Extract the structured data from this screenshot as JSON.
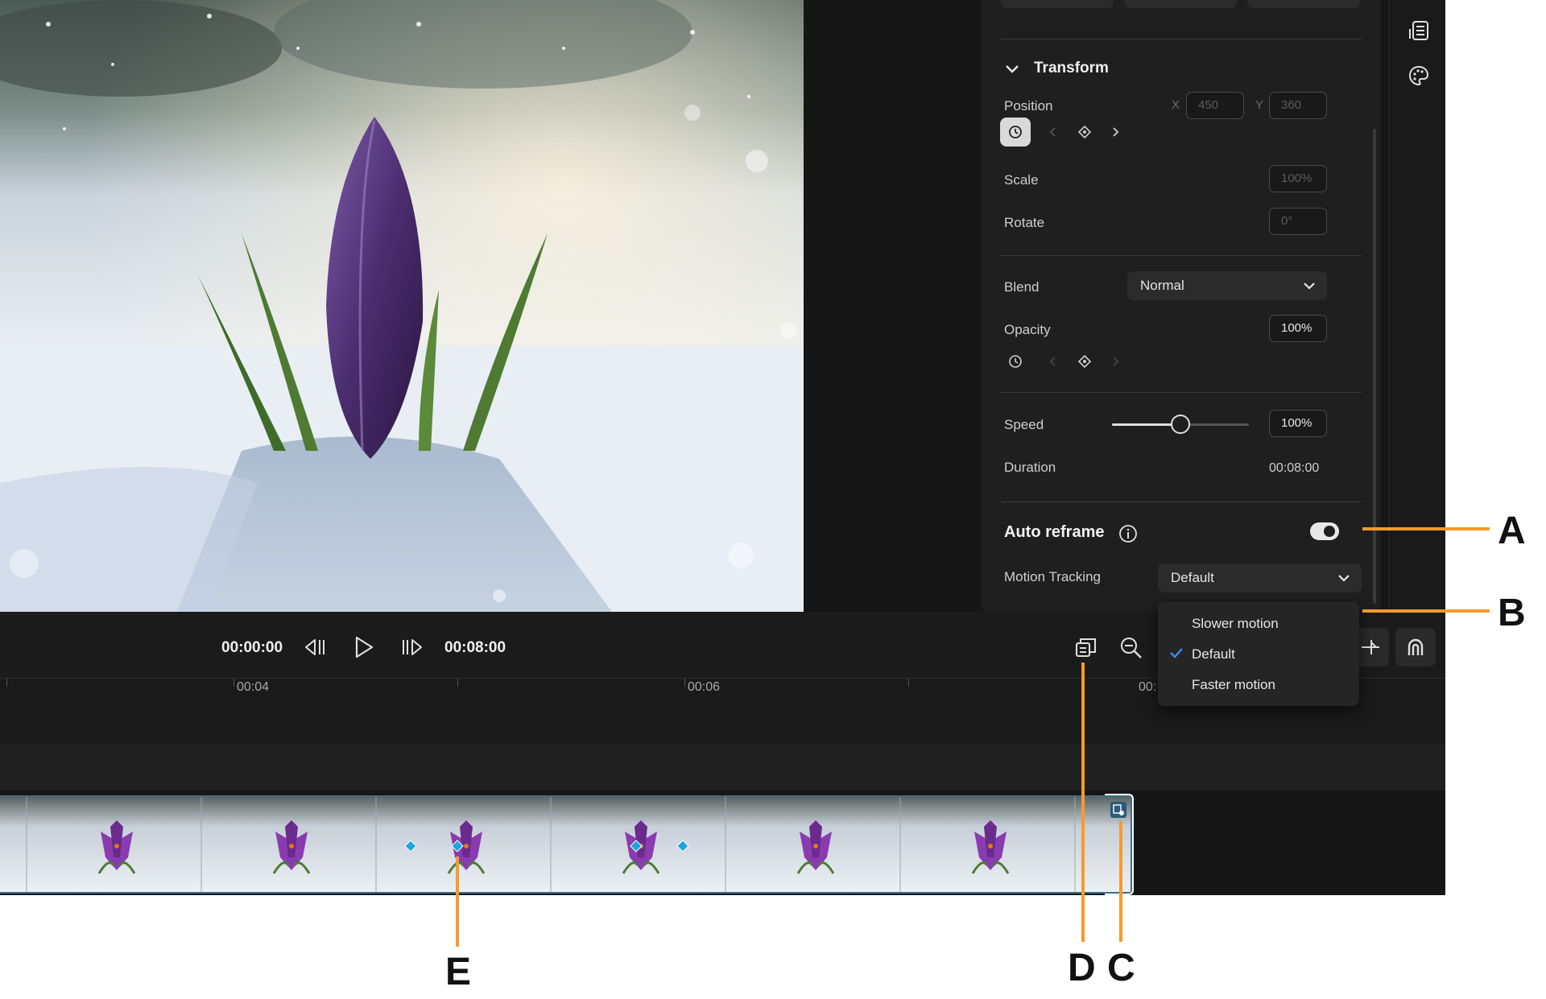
{
  "properties": {
    "section_title": "Transform",
    "position": {
      "label": "Position",
      "x_axis": "X",
      "x_value": "450",
      "y_axis": "Y",
      "y_value": "360"
    },
    "scale": {
      "label": "Scale",
      "value": "100%"
    },
    "rotate": {
      "label": "Rotate",
      "value": "0°"
    },
    "blend": {
      "label": "Blend",
      "value": "Normal"
    },
    "opacity": {
      "label": "Opacity",
      "value": "100%"
    },
    "speed": {
      "label": "Speed",
      "value": "100%",
      "slider_fraction": 0.5
    },
    "duration": {
      "label": "Duration",
      "value": "00:08:00"
    },
    "auto_reframe": {
      "label": "Auto reframe",
      "enabled": true
    },
    "motion_tracking": {
      "label": "Motion Tracking",
      "value": "Default"
    }
  },
  "motion_menu": {
    "options": [
      "Slower motion",
      "Default",
      "Faster motion"
    ],
    "selected": "Default"
  },
  "transport": {
    "current_time": "00:00:00",
    "total_time": "00:08:00"
  },
  "ruler": {
    "ticks": [
      "00:04",
      "00:06",
      "00:"
    ]
  },
  "callouts": {
    "a": "A",
    "b": "B",
    "c": "C",
    "d": "D",
    "e": "E"
  },
  "colors": {
    "accent_orange": "#f59b2b",
    "keyframe_blue": "#1aa6e0",
    "check_blue": "#3b8df0"
  },
  "icons": {
    "rail": [
      "properties-panel-icon",
      "color-palette-icon"
    ],
    "transport": [
      "step-back-icon",
      "play-icon",
      "step-forward-icon",
      "fit-timeline-icon",
      "zoom-out-icon",
      "split-icon",
      "magnet-snap-icon"
    ]
  }
}
